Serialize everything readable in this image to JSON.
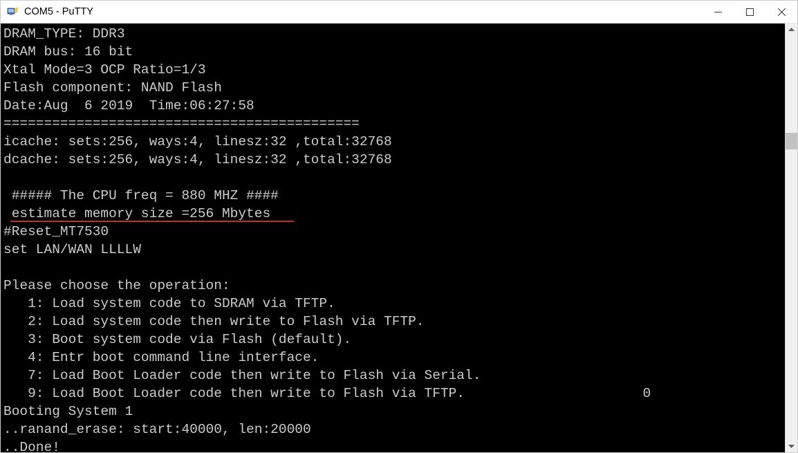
{
  "window": {
    "title": "COM5 - PuTTY"
  },
  "scrollbar": {
    "thumb_top_pct": 24,
    "thumb_height_pct": 4
  },
  "annotation": {
    "underline_target": "estimate memory size =256 Mbytes"
  },
  "terminal": {
    "lines": [
      "DRAM_TYPE: DDR3",
      "DRAM bus: 16 bit",
      "Xtal Mode=3 OCP Ratio=1/3",
      "Flash component: NAND Flash",
      "Date:Aug  6 2019  Time:06:27:58",
      "============================================",
      "icache: sets:256, ways:4, linesz:32 ,total:32768",
      "dcache: sets:256, ways:4, linesz:32 ,total:32768",
      "",
      " ##### The CPU freq = 880 MHZ ####",
      " estimate memory size =256 Mbytes",
      "#Reset_MT7530",
      "set LAN/WAN LLLLW",
      "",
      "Please choose the operation:",
      "   1: Load system code to SDRAM via TFTP.",
      "   2: Load system code then write to Flash via TFTP.",
      "   3: Boot system code via Flash (default).",
      "   4: Entr boot command line interface.",
      "   7: Load Boot Loader code then write to Flash via Serial.",
      "   9: Load Boot Loader code then write to Flash via TFTP.                      0",
      "Booting System 1",
      "..ranand_erase: start:40000, len:20000",
      "..Done!"
    ]
  }
}
